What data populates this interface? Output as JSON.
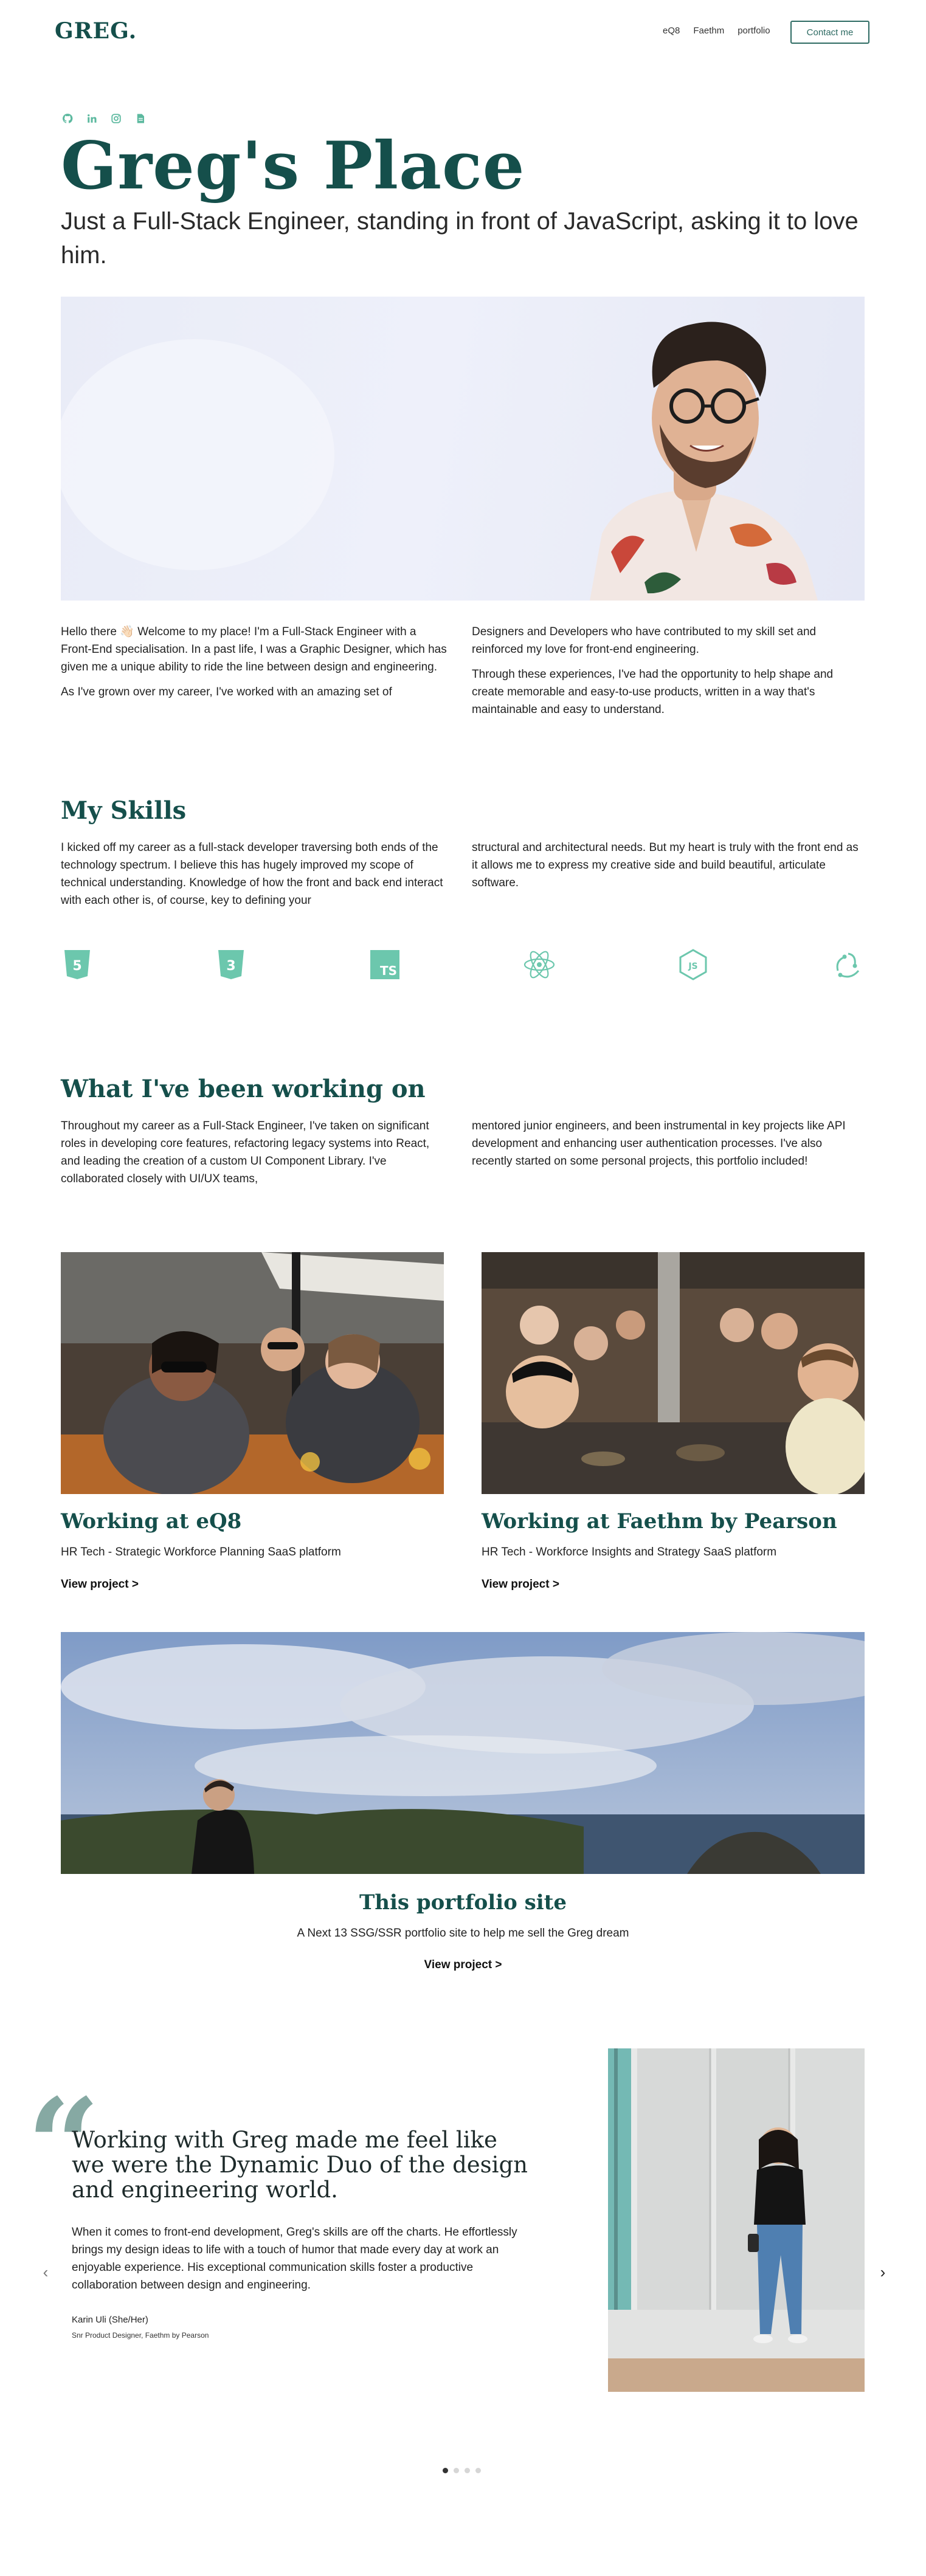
{
  "nav": {
    "logo": "GREG.",
    "links": [
      "eQ8",
      "Faethm",
      "portfolio"
    ],
    "contact_label": "Contact me"
  },
  "hero": {
    "title": "Greg's Place",
    "subtitle": "Just a Full-Stack Engineer, standing in front of JavaScript, asking it to love him.",
    "socials": [
      "github-icon",
      "linkedin-icon",
      "instagram-icon",
      "document-icon"
    ]
  },
  "intro": {
    "p1": "Hello there 👋🏻 Welcome to my place! I'm a Full-Stack Engineer with a Front-End specialisation. In a past life, I was a Graphic Designer, which has given me a unique ability to ride the line between design and engineering.",
    "p2": "As I've grown over my career, I've worked with an amazing set of",
    "p3": "Designers and Developers who have contributed to my skill set and reinforced my love for front-end engineering.",
    "p4": "Through these experiences, I've had the opportunity to help shape and create memorable and easy-to-use products, written in a way that's maintainable and easy to understand."
  },
  "skills": {
    "title": "My Skills",
    "p1": "I kicked off my career as a full-stack developer traversing both ends of the technology spectrum. I believe this has hugely improved my scope of technical understanding. Knowledge of how the front and back end interact with each other is, of course, key to defining your",
    "p2": "structural and architectural needs. But my heart is truly with the front end as it allows me to express my creative side and build beautiful, articulate software.",
    "icons": [
      "html5-icon",
      "css3-icon",
      "typescript-icon",
      "react-icon",
      "nodejs-icon",
      "redux-icon"
    ]
  },
  "work": {
    "title": "What I've been working on",
    "p1": "Throughout my career as a Full-Stack Engineer, I've taken on significant roles in developing core features, refactoring legacy systems into React, and leading the creation of a custom UI Component Library. I've collaborated closely with UI/UX teams,",
    "p2": "mentored junior engineers, and been instrumental in key projects like API development and enhancing user authentication processes. I've also recently started on some personal projects, this portfolio included!",
    "projects": [
      {
        "title": "Working at eQ8",
        "subtitle": "HR Tech - Strategic Workforce Planning SaaS platform",
        "link": "View project >"
      },
      {
        "title": "Working at Faethm by Pearson",
        "subtitle": "HR Tech - Workforce Insights and Strategy SaaS platform",
        "link": "View project >"
      },
      {
        "title": "This portfolio site",
        "subtitle": "A Next 13 SSG/SSR portfolio site to help me sell the Greg dream",
        "link": "View project >"
      }
    ]
  },
  "testimonial": {
    "quote": "Working with Greg made me feel like we were the Dynamic Duo of the design and engineering world.",
    "body": "When it comes to front-end development, Greg's skills are off the charts. He effortlessly brings my design ideas to life with a touch of humor that made every day at work an enjoyable experience. His exceptional communication skills foster a productive collaboration between design and engineering.",
    "name": "Karin Uli (She/Her)",
    "role": "Snr Product Designer, Faethm by Pearson",
    "prev_icon": "‹",
    "next_icon": "›",
    "slides": 4,
    "active_slide": 1
  },
  "colors": {
    "brand": "#154f4b",
    "accent": "#5cb99f"
  }
}
